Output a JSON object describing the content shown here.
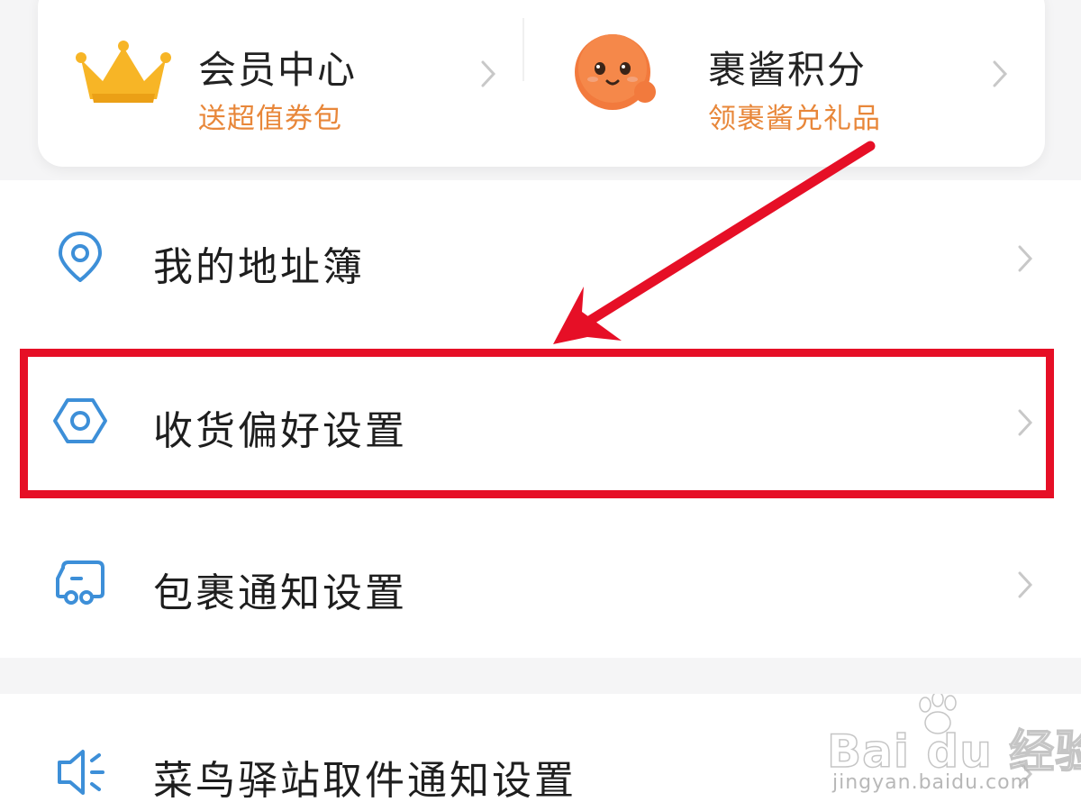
{
  "promos": {
    "member": {
      "title": "会员中心",
      "subtitle": "送超值券包",
      "icon": "crown-icon"
    },
    "points": {
      "title": "裹酱积分",
      "subtitle": "领裹酱兑礼品",
      "icon": "mascot-icon"
    }
  },
  "menu": [
    {
      "label": "我的地址簿",
      "icon": "location-pin-icon"
    },
    {
      "label": "收货偏好设置",
      "icon": "hexagon-settings-icon"
    },
    {
      "label": "包裹通知设置",
      "icon": "delivery-truck-icon"
    }
  ],
  "menu2": [
    {
      "label": "菜鸟驿站取件通知设置",
      "icon": "speaker-icon"
    }
  ],
  "colors": {
    "accent": "#3d8fd8",
    "subtitle": "#e8873a",
    "highlight": "#e60f26"
  },
  "watermark": {
    "brand": "Bai du 经验",
    "url": "jingyan.baidu.com"
  }
}
